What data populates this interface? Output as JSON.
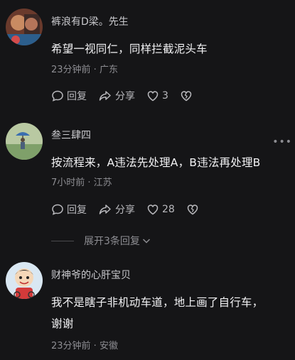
{
  "comments": [
    {
      "author": "裤浪有D梁。先生",
      "text": "希望一视同仁，同样拦截泥头车",
      "meta": "23分钟前 · 广东",
      "reply_label": "回复",
      "share_label": "分享",
      "like_count": "3"
    },
    {
      "author": "叁三肆四",
      "text": "按流程来，A违法先处理A，B违法再处理B",
      "meta": "7小时前 · 江苏",
      "reply_label": "回复",
      "share_label": "分享",
      "like_count": "28",
      "more_label": "•••"
    },
    {
      "author": "财神爷的心肝宝贝",
      "text_line1": "我不是瞎子非机动车道，地上画了自行车，",
      "text_line2": "谢谢",
      "meta": "23分钟前 · 安徽"
    }
  ],
  "expand_replies": {
    "label": "展开3条回复"
  },
  "colors": {
    "background": "#151517",
    "text": "#f2f2f4",
    "muted": "#8d8d92"
  }
}
